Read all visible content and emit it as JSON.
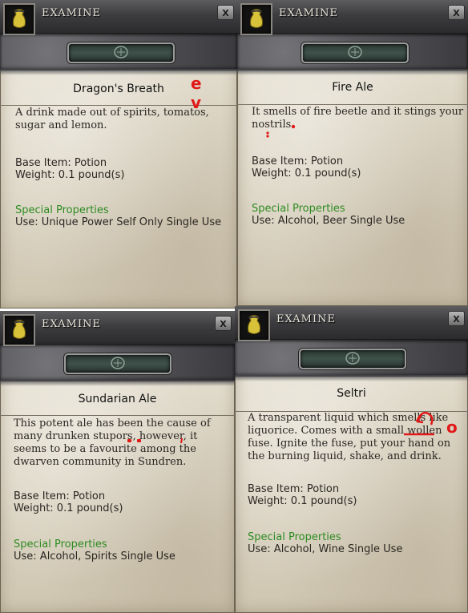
{
  "panels": [
    {
      "window_title": "EXAMINE",
      "close_label": "X",
      "item_name": "Dragon's Breath",
      "description": "A drink made out of spirits, tomatos,\nsugar and lemon.",
      "base_item": "Base Item: Potion",
      "weight": "Weight: 0.1 pound(s)",
      "special_header": "Special Properties",
      "special_use": "Use: Unique Power Self Only Single Use",
      "annotation": "e\nv"
    },
    {
      "window_title": "EXAMINE",
      "close_label": "X",
      "item_name": "Fire Ale",
      "description": "It smells of fire beetle and it stings your\nnostrils.",
      "base_item": "Base Item: Potion",
      "weight": "Weight: 0.1 pound(s)",
      "special_header": "Special Properties",
      "special_use": "Use: Alcohol, Beer Single Use"
    },
    {
      "window_title": "EXAMINE",
      "close_label": "X",
      "item_name": "Sundarian Ale",
      "description": "This potent ale has been the cause of\nmany drunken stupors, however, it\nseems to be a favourite among the\ndwarven community in Sundren.",
      "base_item": "Base Item: Potion",
      "weight": "Weight: 0.1 pound(s)",
      "special_header": "Special Properties",
      "special_use": "Use: Alcohol, Spirits Single Use"
    },
    {
      "window_title": "EXAMINE",
      "close_label": "X",
      "item_name": "Seltri",
      "description": "A transparent liquid which smells like\nliquorice. Comes with a small wollen\nfuse. Ignite the fuse, put your hand on\nthe burning liquid, shake, and drink.",
      "base_item": "Base Item: Potion",
      "weight": "Weight: 0.1 pound(s)",
      "special_header": "Special Properties",
      "special_use": "Use: Alcohol, Wine Single Use",
      "annotation": "o"
    }
  ],
  "colors": {
    "special_properties_green": "#2e8b22",
    "annotation_red": "#e01818",
    "header_dark": "#3d3d40",
    "parchment": "#ddd6c5"
  },
  "icons": {
    "portrait": "potion-bag-icon",
    "close": "close-icon",
    "emblem": "rune-emblem-icon"
  }
}
